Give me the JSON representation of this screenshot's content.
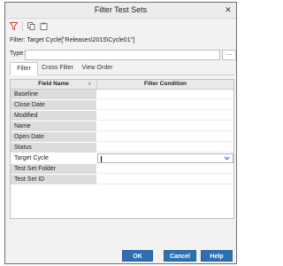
{
  "window": {
    "title": "Filter Test Sets"
  },
  "toolbar": {
    "icons": [
      "filter-icon",
      "copy-icon",
      "paste-icon"
    ]
  },
  "filter_summary": "Filter: Target Cycle[\"Releases\\2015\\Cycle01\"]",
  "type_field": {
    "label": "Type:",
    "value": "",
    "browse_label": "..."
  },
  "tabs": [
    {
      "label": "Filter",
      "active": true
    },
    {
      "label": "Cross Filter",
      "active": false
    },
    {
      "label": "View Order",
      "active": false
    }
  ],
  "grid": {
    "headers": {
      "field_name": "Field Name",
      "filter_condition": "Filter Condition"
    },
    "rows": [
      {
        "field": "Baseline",
        "condition": ""
      },
      {
        "field": "Close Date",
        "condition": ""
      },
      {
        "field": "Modified",
        "condition": ""
      },
      {
        "field": "Name",
        "condition": ""
      },
      {
        "field": "Open Date",
        "condition": ""
      },
      {
        "field": "Status",
        "condition": ""
      },
      {
        "field": "Target Cycle",
        "condition": "",
        "active": true
      },
      {
        "field": "Test Set Folder",
        "condition": ""
      },
      {
        "field": "Test Set ID",
        "condition": ""
      }
    ]
  },
  "buttons": {
    "ok": "OK",
    "cancel": "Cancel",
    "help": "Help"
  },
  "colors": {
    "button_blue": "#2e6fb2",
    "field_bg": "#dcdcdc",
    "dropdown_arrow": "#2a7ab8"
  }
}
